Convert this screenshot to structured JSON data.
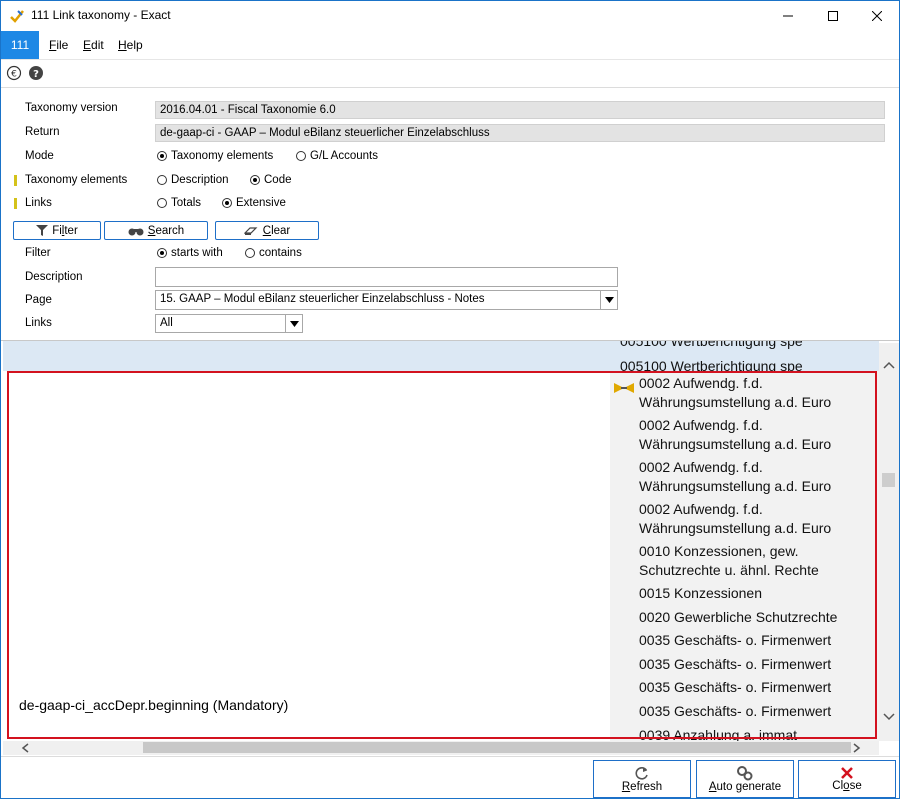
{
  "window": {
    "title": "111 Link taxonomy - Exact",
    "controls": [
      "minimize-icon",
      "maximize-icon",
      "close-icon"
    ]
  },
  "menubar": {
    "tag": "111",
    "items": [
      {
        "first": "F",
        "rest": "ile"
      },
      {
        "first": "E",
        "rest": "dit"
      },
      {
        "first": "H",
        "rest": "elp"
      }
    ]
  },
  "toolbar": {
    "icons": [
      "euro-icon",
      "help-icon"
    ]
  },
  "form": {
    "taxonomy_version_label": "Taxonomy version",
    "taxonomy_version_value": "2016.04.01 - Fiscal Taxonomie 6.0",
    "return_label": "Return",
    "return_value": "de-gaap-ci - GAAP – Modul eBilanz steuerlicher Einzelabschluss",
    "mode_label": "Mode",
    "mode_options": [
      "Taxonomy elements",
      "G/L Accounts"
    ],
    "mode_selected": "Taxonomy elements",
    "taxonomy_elements_label": "Taxonomy elements",
    "taxonomy_elements_options": [
      "Description",
      "Code"
    ],
    "taxonomy_elements_selected": "Code",
    "links_label": "Links",
    "links_options": [
      "Totals",
      "Extensive"
    ],
    "links_selected": "Extensive",
    "filter_button": {
      "first": "Fi",
      "u": "l",
      "rest": "ter"
    },
    "search_button": {
      "first": "",
      "u": "S",
      "rest": "earch"
    },
    "clear_button": {
      "first": "",
      "u": "C",
      "rest": "lear"
    },
    "filter_label": "Filter",
    "filter_options": [
      "starts with",
      "contains"
    ],
    "filter_selected": "starts with",
    "description_label": "Description",
    "description_value": "",
    "page_label": "Page",
    "page_value": "15.  GAAP – Modul eBilanz steuerlicher Einzelabschluss - Notes",
    "links2_label": "Links",
    "links2_value": "All"
  },
  "list": {
    "clipped_top": "005100 Wertberichtigung spe",
    "header_row": "005100 Wertberichtigung spe",
    "left_description": "de-gaap-ci_accDepr.beginning (Mandatory)",
    "items": [
      {
        "l1": "0002 Aufwendg. f.d.",
        "l2": "Währungsumstellung a.d. Euro",
        "icon": true
      },
      {
        "l1": "0002 Aufwendg. f.d.",
        "l2": "Währungsumstellung a.d. Euro"
      },
      {
        "l1": "0002 Aufwendg. f.d.",
        "l2": "Währungsumstellung a.d. Euro"
      },
      {
        "l1": "0002 Aufwendg. f.d.",
        "l2": "Währungsumstellung a.d. Euro"
      },
      {
        "l1": "0010 Konzessionen, gew.",
        "l2": "Schutzrechte u. ähnl. Rechte"
      },
      {
        "l1": "0015 Konzessionen"
      },
      {
        "l1": "0020 Gewerbliche Schutzrechte"
      },
      {
        "l1": "0035 Geschäfts- o. Firmenwert"
      },
      {
        "l1": "0035 Geschäfts- o. Firmenwert"
      },
      {
        "l1": "0035 Geschäfts- o. Firmenwert"
      },
      {
        "l1": "0035 Geschäfts- o. Firmenwert"
      },
      {
        "l1": "0039 Anzahlung a. immat"
      }
    ]
  },
  "bottom": {
    "refresh": {
      "u": "R",
      "rest": "efresh"
    },
    "auto_generate": {
      "first": "",
      "u": "A",
      "rest": "uto generate"
    },
    "close": {
      "first": "Cl",
      "u": "o",
      "rest": "se"
    }
  },
  "colors": {
    "accent": "#1e88e5",
    "highlight_border": "#d3121f",
    "row_highlight": "#dce8f4"
  }
}
